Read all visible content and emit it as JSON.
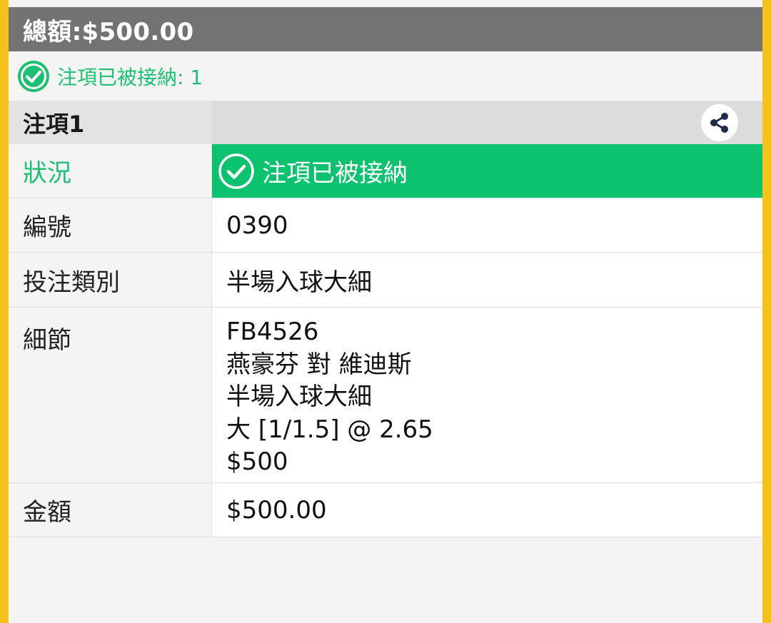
{
  "header": {
    "total": "總額:$500.00"
  },
  "accepted_bar": {
    "text": "注項已被接納: 1",
    "icon": "check-circle-icon"
  },
  "bet": {
    "title": "注項1",
    "share_icon": "share-icon"
  },
  "rows": {
    "status": {
      "label": "狀況",
      "value": "注項已被接納"
    },
    "number": {
      "label": "編號",
      "value": "0390"
    },
    "type": {
      "label": "投注類別",
      "value": "半場入球大細"
    },
    "details": {
      "label": "細節",
      "lines": [
        "FB4526",
        "燕豪芬 對 維迪斯",
        "半場入球大細",
        "大 [1/1.5] @ 2.65",
        "$500"
      ]
    },
    "amount": {
      "label": "金額",
      "value": "$500.00"
    }
  },
  "colors": {
    "frame_border": "#f4c21a",
    "header_bg": "#737373",
    "accent_green": "#1fbf73",
    "status_bg": "#0dc26e"
  }
}
